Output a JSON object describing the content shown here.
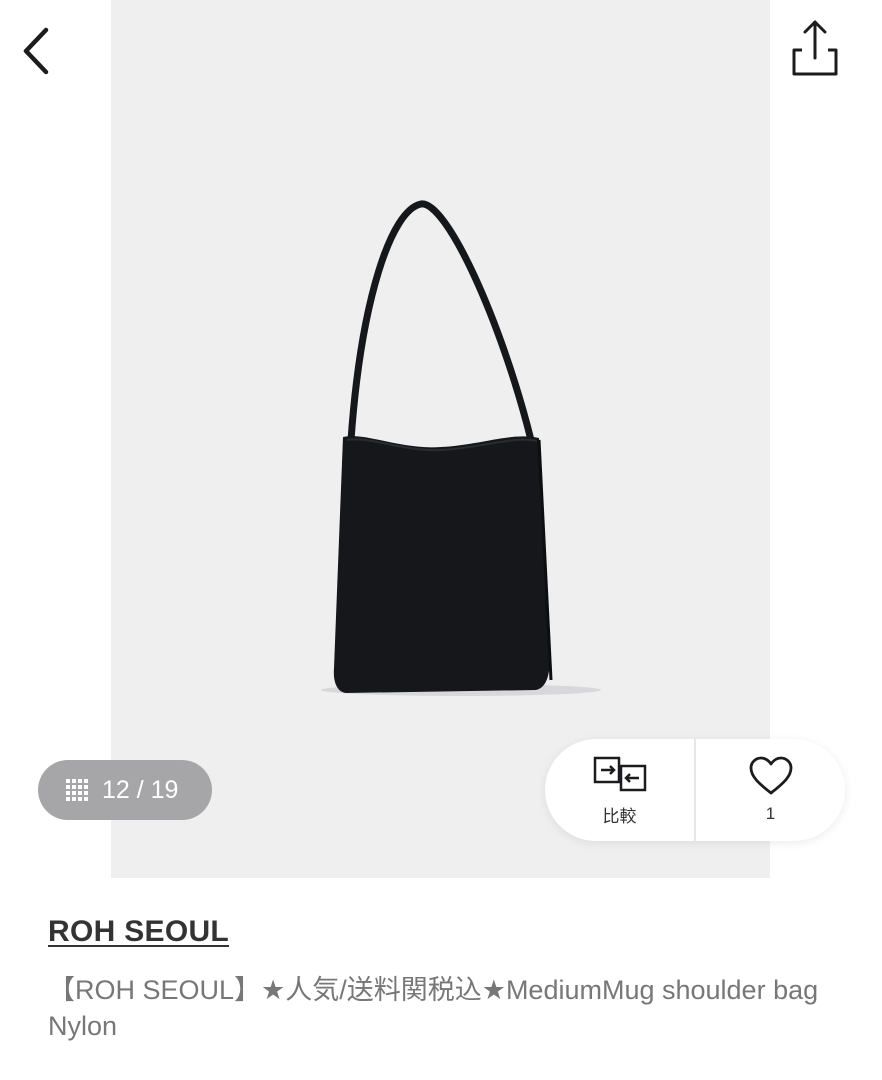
{
  "gallery": {
    "current": "12",
    "total": "19",
    "counter_text": "12 / 19"
  },
  "actions": {
    "compare_label": "比較",
    "favorite_count": "1"
  },
  "product": {
    "brand": "ROH SEOUL",
    "title": "【ROH SEOUL】★人気/送料関税込★MediumMug shoulder bag Nylon"
  },
  "icons": {
    "back": "chevron-left-icon",
    "share": "share-icon",
    "grid": "grid-icon",
    "compare": "compare-icon",
    "favorite": "heart-icon"
  },
  "colors": {
    "photo_background": "#efeff0",
    "bag": "#16171a",
    "pill_background": "#a6a6a8",
    "text_primary": "#333333",
    "text_secondary": "#777777"
  }
}
